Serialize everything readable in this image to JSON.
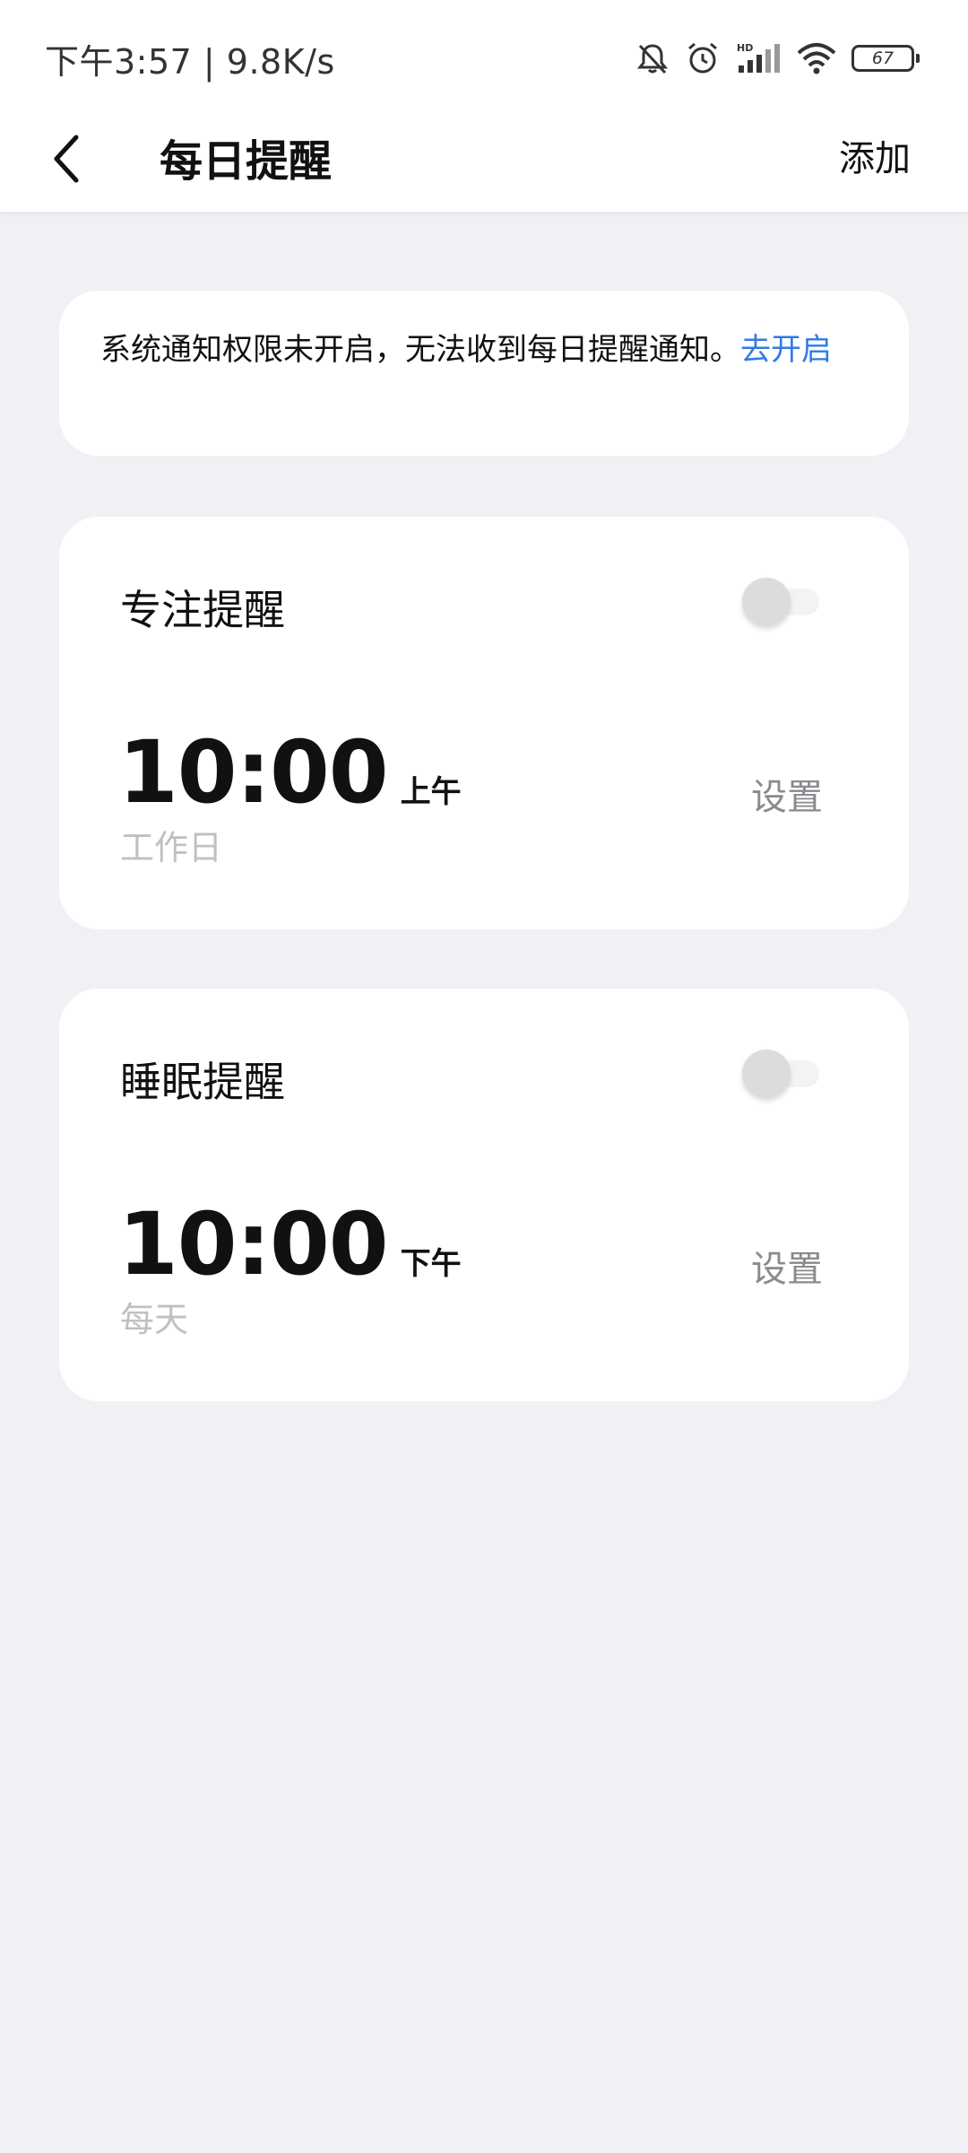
{
  "status_bar": {
    "time": "下午3:57 | 9.8K/s",
    "battery": "67",
    "icons": [
      "bell-off-icon",
      "alarm-icon",
      "hd-signal-icon",
      "wifi-icon",
      "battery-icon"
    ]
  },
  "nav": {
    "back_icon": "chevron-left-icon",
    "title": "每日提醒",
    "action_label": "添加"
  },
  "notice": {
    "text": "系统通知权限未开启，无法收到每日提醒通知。",
    "link_label": "去开启",
    "link_color": "#2f7be5"
  },
  "reminders": [
    {
      "title": "专注提醒",
      "enabled": false,
      "time": "10:00",
      "period": "上午",
      "repeat": "工作日",
      "set_label": "设置"
    },
    {
      "title": "睡眠提醒",
      "enabled": false,
      "time": "10:00",
      "period": "下午",
      "repeat": "每天",
      "set_label": "设置"
    }
  ],
  "colors": {
    "background": "#f1f1f5",
    "card": "#ffffff",
    "accent": "#2f7be5",
    "muted_text": "#c0c0c4"
  }
}
